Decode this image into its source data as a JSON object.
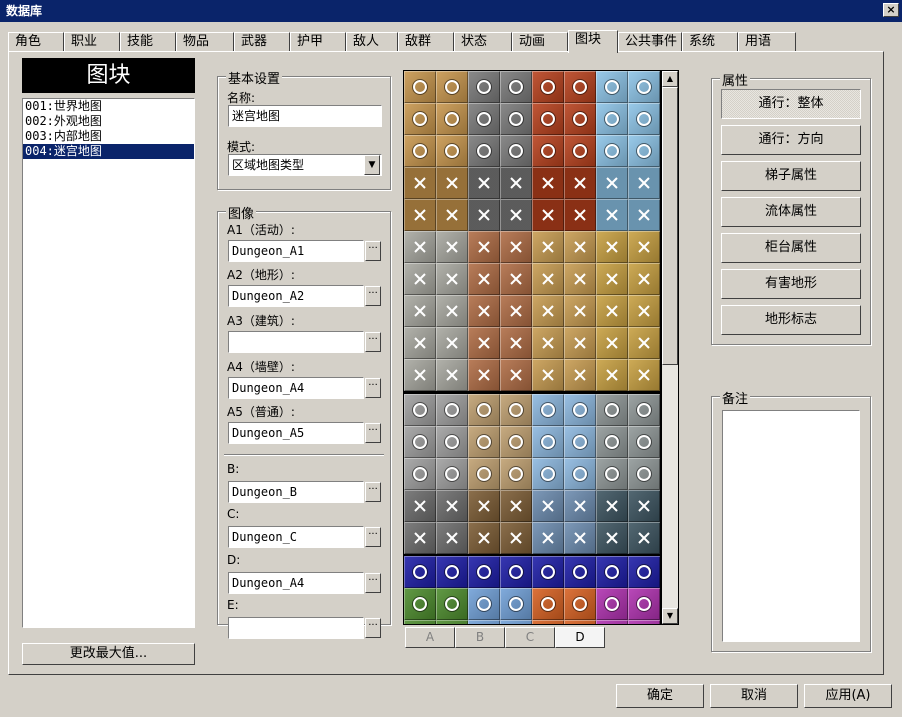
{
  "window": {
    "title": "数据库",
    "close_label": "×"
  },
  "tabs": [
    {
      "label": "角色"
    },
    {
      "label": "职业"
    },
    {
      "label": "技能"
    },
    {
      "label": "物品"
    },
    {
      "label": "武器"
    },
    {
      "label": "护甲"
    },
    {
      "label": "敌人"
    },
    {
      "label": "敌群"
    },
    {
      "label": "状态"
    },
    {
      "label": "动画"
    },
    {
      "label": "图块",
      "active": true
    },
    {
      "label": "公共事件"
    },
    {
      "label": "系统"
    },
    {
      "label": "用语"
    }
  ],
  "list_panel": {
    "heading": "图块",
    "items": [
      "001:世界地图",
      "002:外观地图",
      "003:内部地图",
      "004:迷宫地图"
    ],
    "selected_index": 3,
    "change_max_label": "更改最大值..."
  },
  "basic": {
    "group_title": "基本设置",
    "name_label": "名称:",
    "name_value": "迷宫地图",
    "mode_label": "模式:",
    "mode_value": "区域地图类型"
  },
  "images": {
    "group_title": "图像",
    "dots": "···",
    "slots": [
      {
        "label": "A1（活动）:",
        "value": "Dungeon_A1"
      },
      {
        "label": "A2（地形）:",
        "value": "Dungeon_A2"
      },
      {
        "label": "A3（建筑）:",
        "value": ""
      },
      {
        "label": "A4（墙壁）:",
        "value": "Dungeon_A4"
      },
      {
        "label": "A5（普通）:",
        "value": "Dungeon_A5"
      },
      {
        "label": "B:",
        "value": "Dungeon_B"
      },
      {
        "label": "C:",
        "value": "Dungeon_C"
      },
      {
        "label": "D:",
        "value": "Dungeon_A4"
      },
      {
        "label": "E:",
        "value": ""
      }
    ]
  },
  "tileset_tabs": [
    {
      "label": "A"
    },
    {
      "label": "B"
    },
    {
      "label": "C"
    },
    {
      "label": "D",
      "active": true
    }
  ],
  "properties": {
    "group_title": "属性",
    "buttons": [
      "通行：整体",
      "通行：方向",
      "梯子属性",
      "流体属性",
      "柜台属性",
      "有害地形",
      "地形标志"
    ],
    "active_index": 0
  },
  "notes": {
    "group_title": "备注",
    "value": ""
  },
  "footer": {
    "ok_label": "确定",
    "cancel_label": "取消",
    "apply_label": "应用(A)"
  },
  "icons": {
    "mode_dropdown": "chevron-down-icon",
    "scroll_up": "arrow-up-icon",
    "scroll_down": "arrow-down-icon",
    "close": "close-icon"
  },
  "colors": {
    "titlebar": "#0a246a",
    "selection": "#0a246a",
    "face": "#d4d0c8"
  }
}
